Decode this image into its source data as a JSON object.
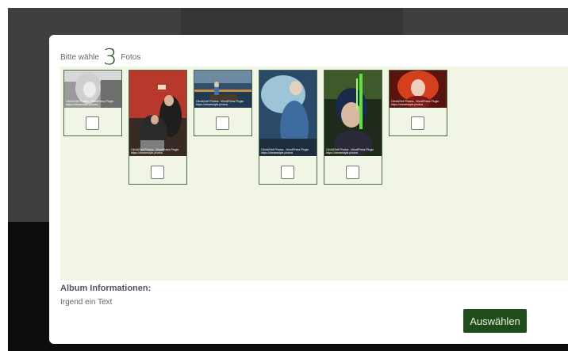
{
  "dialog": {
    "prompt_prefix": "Bitte wähle",
    "photo_count": "3",
    "prompt_suffix": "Fotos"
  },
  "photos": [
    {
      "watermark_line1": "Click&Sell Photos - WordPress Plugin",
      "watermark_line2": "https://dreamstyle.photos"
    },
    {
      "watermark_line1": "Click&Sell Photos - WordPress Plugin",
      "watermark_line2": "https://dreamstyle.photos"
    },
    {
      "watermark_line1": "Click&Sell Photos - WordPress Plugin",
      "watermark_line2": "https://dreamstyle.photos"
    },
    {
      "watermark_line1": "Click&Sell Photos - WordPress Plugin",
      "watermark_line2": "https://dreamstyle.photos"
    },
    {
      "watermark_line1": "Click&Sell Photos - WordPress Plugin",
      "watermark_line2": "https://dreamstyle.photos"
    },
    {
      "watermark_line1": "Click&Sell Photos - WordPress Plugin",
      "watermark_line2": "https://dreamstyle.photos"
    }
  ],
  "album": {
    "label": "Album Informationen:",
    "text": "Irgend ein Text"
  },
  "actions": {
    "select_label": "Auswählen"
  },
  "colors": {
    "accent": "#1f4d1a",
    "gallery_bg": "#f0f5e6",
    "card_border": "#4a6a45"
  }
}
